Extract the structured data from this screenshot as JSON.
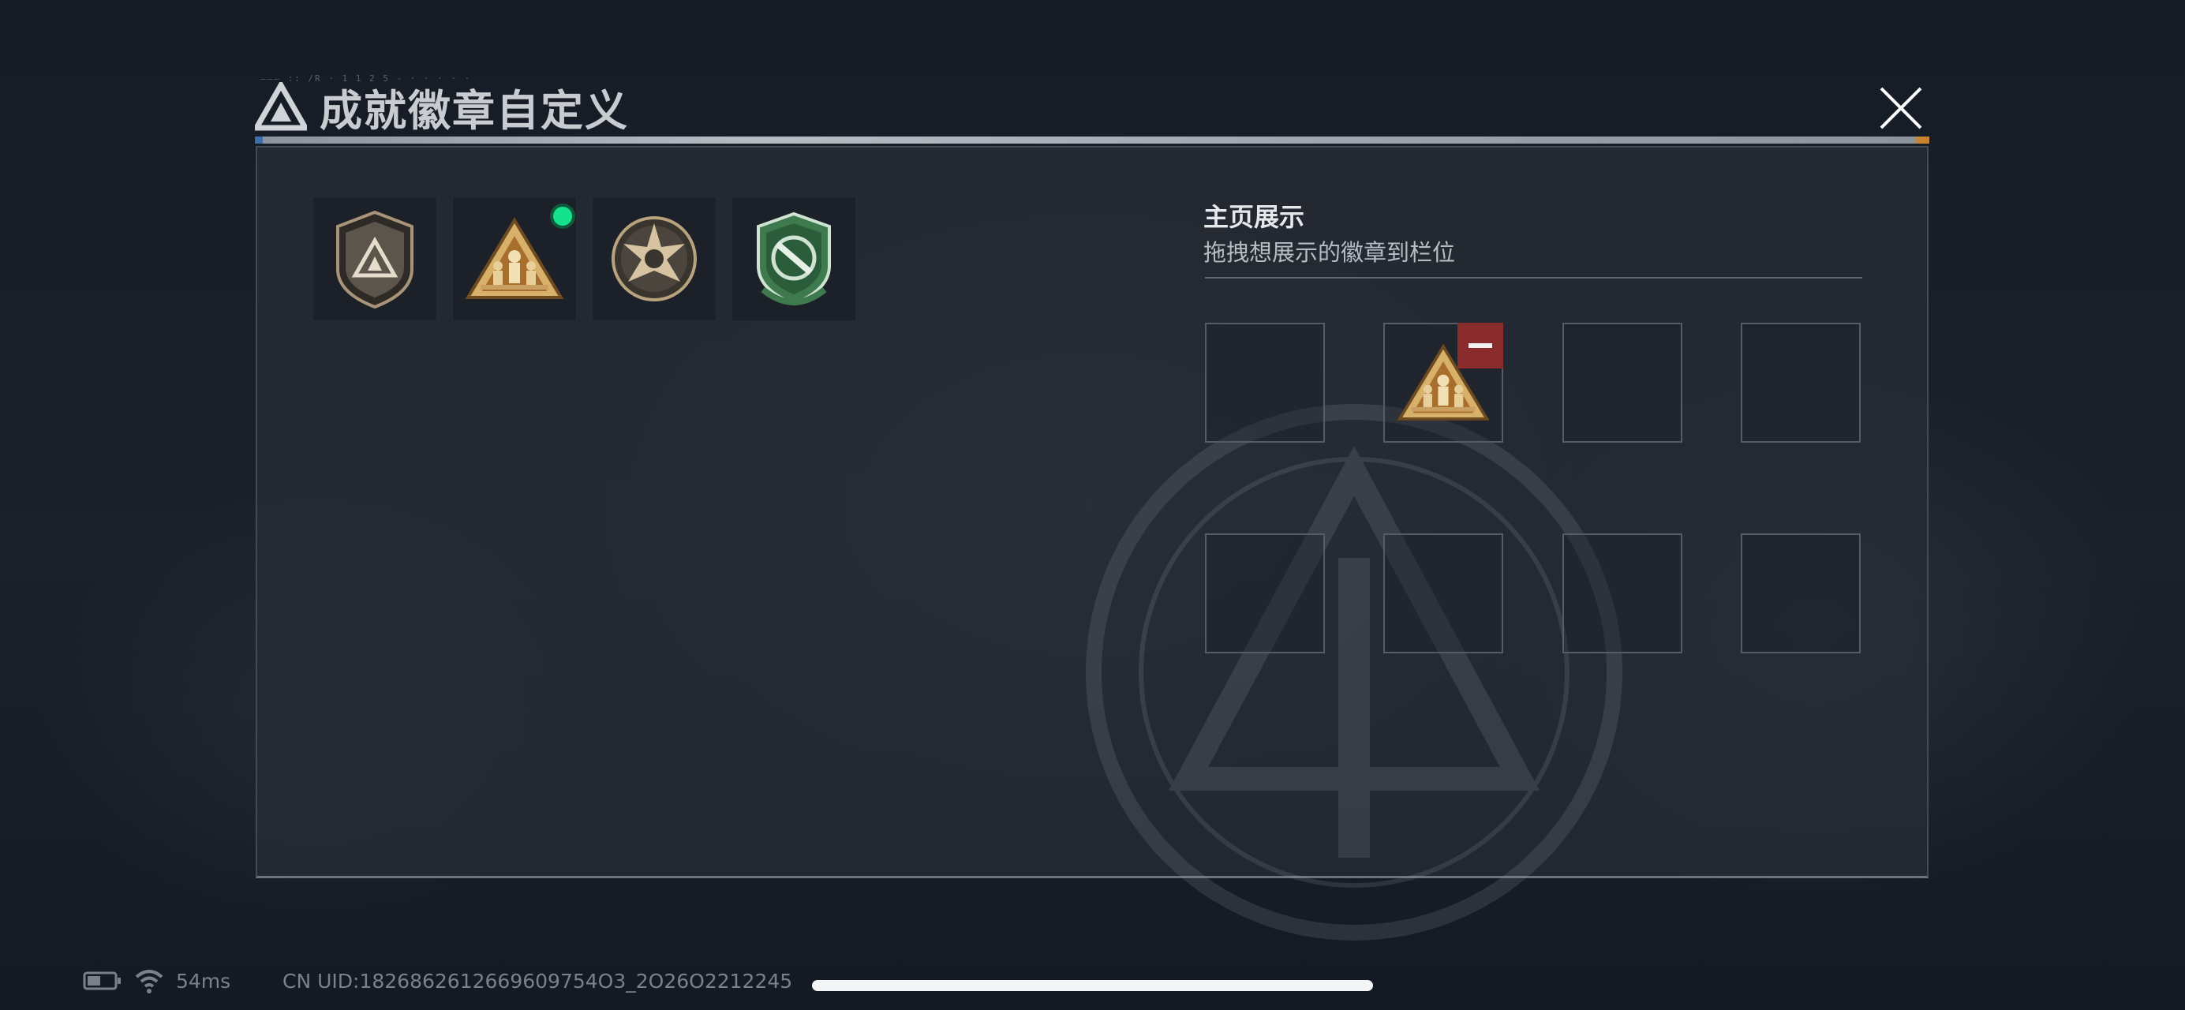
{
  "dialog": {
    "title": "成就徽章自定义",
    "micro_text": "——— :: /R · 1 1 2 5 - · · · · ·"
  },
  "inventory": {
    "badges": [
      {
        "name": "shield-delta-badge",
        "has_new_indicator": false
      },
      {
        "name": "triangle-soldiers-badge",
        "has_new_indicator": true
      },
      {
        "name": "star-emblem-badge",
        "has_new_indicator": false
      },
      {
        "name": "green-shield-badge",
        "has_new_indicator": false
      }
    ]
  },
  "showcase": {
    "title": "主页展示",
    "hint": "拖拽想展示的徽章到栏位",
    "slots": [
      {
        "index": 1,
        "badge": null
      },
      {
        "index": 2,
        "badge": "triangle-soldiers-badge",
        "removable": true
      },
      {
        "index": 3,
        "badge": null
      },
      {
        "index": 4,
        "badge": null
      },
      {
        "index": 5,
        "badge": null
      },
      {
        "index": 6,
        "badge": null
      },
      {
        "index": 7,
        "badge": null
      },
      {
        "index": 8,
        "badge": null
      }
    ]
  },
  "status_bar": {
    "ping": "54ms",
    "uid": "CN UID:1826862612669609754O3_2O26O2212245"
  },
  "colors": {
    "new_indicator": "#16e28e",
    "remove_button": "#8a2b2c",
    "accent_orange": "#c8842e",
    "accent_blue": "#3f6fa8"
  }
}
